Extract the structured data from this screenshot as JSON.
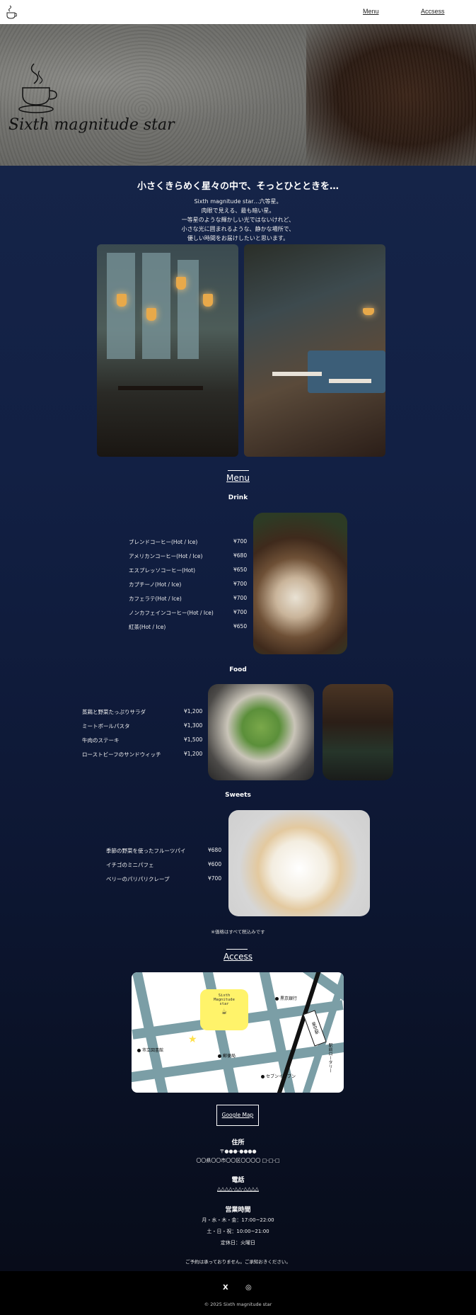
{
  "header": {
    "nav": [
      {
        "label": "Menu"
      },
      {
        "label": "Accsess"
      }
    ]
  },
  "hero": {
    "title": "Sixth magnitude star"
  },
  "intro": {
    "tagline": "小さくきらめく星々の中で、そっとひとときを…",
    "lines": [
      "Sixth magnitude star…六等星。",
      "肉眼で見える、最も暗い星。",
      "一等星のような輝かしい光ではないけれど、",
      "小さな光に囲まれるような、静かな場所で、",
      "優しい時間をお届けしたいと思います。"
    ]
  },
  "menu": {
    "heading": "Menu",
    "drink": {
      "heading": "Drink",
      "items": [
        {
          "name": "ブレンドコーヒー(Hot / Ice)",
          "price": "¥700"
        },
        {
          "name": "アメリカンコーヒー(Hot / Ice)",
          "price": "¥680"
        },
        {
          "name": "エスプレッソコーヒー(Hot)",
          "price": "¥650"
        },
        {
          "name": "カプチーノ(Hot / Ice)",
          "price": "¥700"
        },
        {
          "name": "カフェラテ(Hot / Ice)",
          "price": "¥700"
        },
        {
          "name": "ノンカフェインコーヒー(Hot / Ice)",
          "price": "¥700"
        },
        {
          "name": "紅茶(Hot / Ice)",
          "price": "¥650"
        }
      ]
    },
    "food": {
      "heading": "Food",
      "items": [
        {
          "name": "蒸鶏と野菜たっぷりサラダ",
          "price": "¥1,200"
        },
        {
          "name": "ミートボールパスタ",
          "price": "¥1,300"
        },
        {
          "name": "牛肉のステーキ",
          "price": "¥1,500"
        },
        {
          "name": "ローストビーフのサンドウィッチ",
          "price": "¥1,200"
        }
      ]
    },
    "sweets": {
      "heading": "Sweets",
      "items": [
        {
          "name": "季節の野菜を使ったフルーツパイ",
          "price": "¥680"
        },
        {
          "name": "イチゴのミニパフェ",
          "price": "¥600"
        },
        {
          "name": "ベリーのパリパリクレープ",
          "price": "¥700"
        }
      ]
    },
    "note": "※価格はすべて税込みです"
  },
  "access": {
    "heading": "Access",
    "map": {
      "bubble_line1": "Sixth",
      "bubble_line2": "Magnitude",
      "bubble_line3": "star",
      "labels": {
        "bank": "黒京銀行",
        "library": "市立図書館",
        "post": "郵便局",
        "store": "セブンイレブン",
        "station": "星空駅",
        "rotary": "駅前ロータリー"
      }
    },
    "google_map": "Google Map",
    "address_heading": "住所",
    "postal": "〒●●●-●●●●",
    "address": "〇〇県〇〇市〇〇区〇〇〇〇 □-□-□",
    "phone_heading": "電話",
    "phone": "△△△△-△△-△△△△",
    "hours_heading": "営業時間",
    "hours_weekday": "月・水・木・金：17:00~22:00",
    "hours_weekend": "土・日・祝：10:00~21:00",
    "closed": "定休日：火曜日",
    "reservation": "ご予約は承っておりません。ご承知おきください。"
  },
  "footer": {
    "x_icon": "X",
    "instagram_icon": "◎",
    "copyright": "© 2025 Sixth magnitude star"
  }
}
